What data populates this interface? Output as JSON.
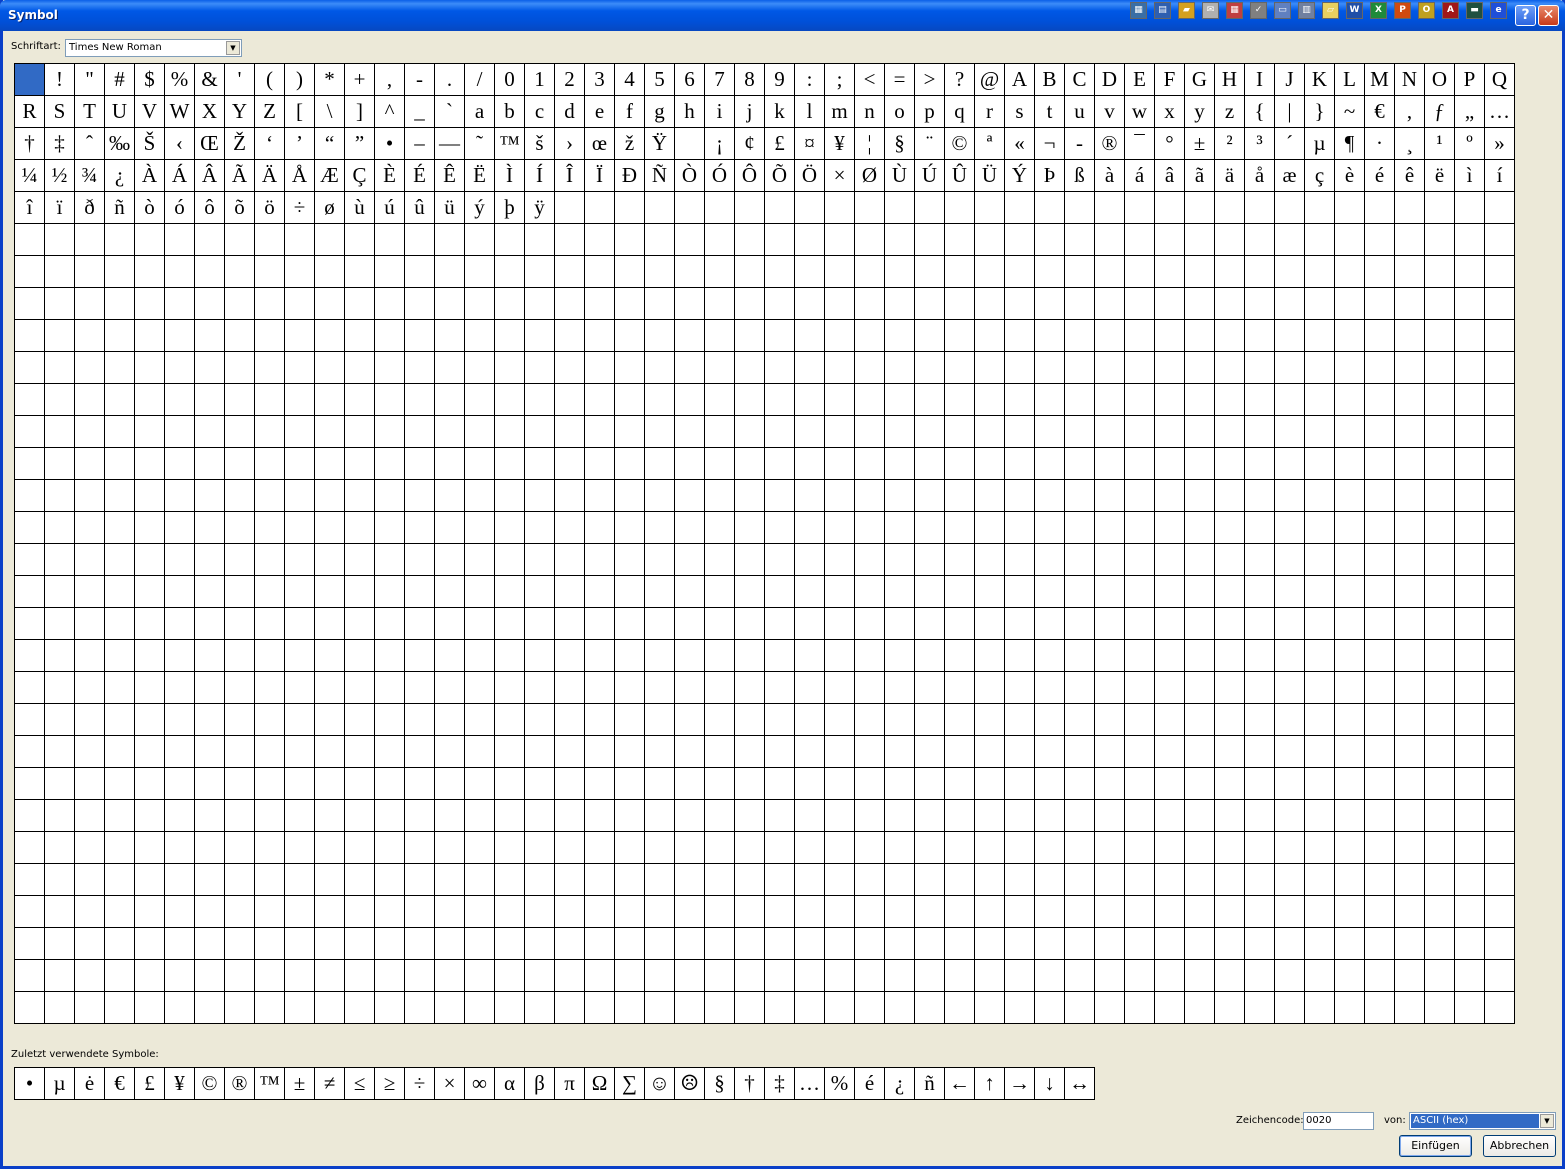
{
  "window": {
    "title": "Symbol"
  },
  "tray_icons": [
    {
      "icon": "windows-flag-icon",
      "glyph": "▦",
      "color": "#3A6EA5"
    },
    {
      "icon": "window-list-icon",
      "glyph": "▤",
      "color": "#2E5FB0"
    },
    {
      "icon": "folder-icon",
      "glyph": "▰",
      "color": "#D4A020"
    },
    {
      "icon": "mail-icon",
      "glyph": "✉",
      "color": "#B0B0B0"
    },
    {
      "icon": "calendar-icon",
      "glyph": "▦",
      "color": "#C04040"
    },
    {
      "icon": "tasks-icon",
      "glyph": "✓",
      "color": "#808080"
    },
    {
      "icon": "contacts-icon",
      "glyph": "▭",
      "color": "#6080C0"
    },
    {
      "icon": "document-icon",
      "glyph": "▥",
      "color": "#7080A0"
    },
    {
      "icon": "notes-icon",
      "glyph": "▱",
      "color": "#E8D060"
    },
    {
      "icon": "word-icon",
      "glyph": "W",
      "color": "#1F4FA8"
    },
    {
      "icon": "excel-icon",
      "glyph": "X",
      "color": "#1F8A3A"
    },
    {
      "icon": "powerpoint-icon",
      "glyph": "P",
      "color": "#D04A10"
    },
    {
      "icon": "outlook-icon",
      "glyph": "O",
      "color": "#C0A020"
    },
    {
      "icon": "access-icon",
      "glyph": "A",
      "color": "#A01818"
    },
    {
      "icon": "desktop-icon",
      "glyph": "▬",
      "color": "#205040"
    },
    {
      "icon": "ie-icon",
      "glyph": "e",
      "color": "#1F4FD8"
    }
  ],
  "title_buttons": {
    "help": "?",
    "close": "✕"
  },
  "font": {
    "label": "Schriftart:",
    "value": "Times New Roman"
  },
  "grid": {
    "rows": [
      [
        " ",
        "!",
        "\"",
        "#",
        "$",
        "%",
        "&",
        "'",
        "(",
        ")",
        "*",
        "+",
        ",",
        "-",
        ".",
        "/",
        "0",
        "1",
        "2",
        "3",
        "4",
        "5",
        "6",
        "7",
        "8",
        "9",
        ":",
        ";",
        "<",
        "=",
        ">",
        "?",
        "@",
        "A",
        "B",
        "C",
        "D",
        "E",
        "F",
        "G",
        "H",
        "I",
        "J",
        "K",
        "L",
        "M",
        "N",
        "O",
        "P",
        "Q"
      ],
      [
        "R",
        "S",
        "T",
        "U",
        "V",
        "W",
        "X",
        "Y",
        "Z",
        "[",
        "\\",
        "]",
        "^",
        "_",
        "`",
        "a",
        "b",
        "c",
        "d",
        "e",
        "f",
        "g",
        "h",
        "i",
        "j",
        "k",
        "l",
        "m",
        "n",
        "o",
        "p",
        "q",
        "r",
        "s",
        "t",
        "u",
        "v",
        "w",
        "x",
        "y",
        "z",
        "{",
        "|",
        "}",
        "~",
        "€",
        ",",
        "ƒ",
        "„",
        "…"
      ],
      [
        "†",
        "‡",
        "ˆ",
        "‰",
        "Š",
        "‹",
        "Œ",
        "Ž",
        "‘",
        "’",
        "“",
        "”",
        "•",
        "–",
        "—",
        "˜",
        "™",
        "š",
        "›",
        "œ",
        "ž",
        "Ÿ",
        " ",
        "¡",
        "¢",
        "£",
        "¤",
        "¥",
        "¦",
        "§",
        "¨",
        "©",
        "ª",
        "«",
        "¬",
        "-",
        "®",
        "¯",
        "°",
        "±",
        "²",
        "³",
        "´",
        "µ",
        "¶",
        "·",
        "¸",
        "¹",
        "º",
        "»"
      ],
      [
        "¼",
        "½",
        "¾",
        "¿",
        "À",
        "Á",
        "Â",
        "Ã",
        "Ä",
        "Å",
        "Æ",
        "Ç",
        "È",
        "É",
        "Ê",
        "Ë",
        "Ì",
        "Í",
        "Î",
        "Ï",
        "Ð",
        "Ñ",
        "Ò",
        "Ó",
        "Ô",
        "Õ",
        "Ö",
        "×",
        "Ø",
        "Ù",
        "Ú",
        "Û",
        "Ü",
        "Ý",
        "Þ",
        "ß",
        "à",
        "á",
        "â",
        "ã",
        "ä",
        "å",
        "æ",
        "ç",
        "è",
        "é",
        "ê",
        "ë",
        "ì",
        "í"
      ],
      [
        "î",
        "ï",
        "ð",
        "ñ",
        "ò",
        "ó",
        "ô",
        "õ",
        "ö",
        "÷",
        "ø",
        "ù",
        "ú",
        "û",
        "ü",
        "ý",
        "þ",
        "ÿ"
      ]
    ]
  },
  "recent": {
    "label": "Zuletzt verwendete Symbole:",
    "symbols": [
      "•",
      "µ",
      "ė",
      "€",
      "£",
      "¥",
      "©",
      "®",
      "™",
      "±",
      "≠",
      "≤",
      "≥",
      "÷",
      "×",
      "∞",
      "α",
      "β",
      "π",
      "Ω",
      "∑",
      "☺",
      "☹",
      "§",
      "†",
      "‡",
      "…",
      "%",
      "é",
      "¿",
      "ñ",
      "←",
      "↑",
      "→",
      "↓",
      "↔"
    ]
  },
  "code": {
    "label": "Zeichencode:",
    "value": "0020"
  },
  "von": {
    "label": "von:",
    "value": "ASCII (hex)"
  },
  "buttons": {
    "insert": "Einfügen",
    "cancel": "Abbrechen"
  }
}
